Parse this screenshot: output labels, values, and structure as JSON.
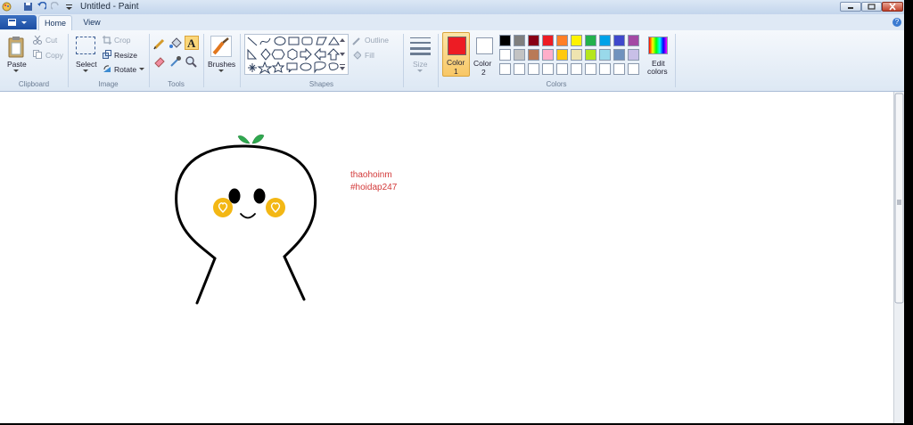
{
  "window": {
    "title": "Untitled - Paint"
  },
  "tabs": {
    "home": "Home",
    "view": "View"
  },
  "clipboard": {
    "paste": "Paste",
    "cut": "Cut",
    "copy": "Copy",
    "group": "Clipboard"
  },
  "image": {
    "select": "Select",
    "crop": "Crop",
    "resize": "Resize",
    "rotate": "Rotate",
    "group": "Image"
  },
  "tools": {
    "group": "Tools",
    "brushes": "Brushes"
  },
  "shapes": {
    "outline": "Outline",
    "fill": "Fill",
    "group": "Shapes"
  },
  "size": {
    "label": "Size"
  },
  "colors": {
    "color1_label": "Color",
    "color1_num": "1",
    "color2_label": "Color",
    "color2_num": "2",
    "edit_label": "Edit",
    "edit_label2": "colors",
    "group": "Colors",
    "primary": "#ed1c24",
    "secondary": "#ffffff",
    "row1": [
      "#000000",
      "#7f7f7f",
      "#880015",
      "#ed1c24",
      "#ff7f27",
      "#fff200",
      "#22b14c",
      "#00a2e8",
      "#3f48cc",
      "#a349a4"
    ],
    "row2": [
      "#ffffff",
      "#c3c3c3",
      "#b97a57",
      "#ffaec9",
      "#ffc90e",
      "#efe4b0",
      "#b5e61d",
      "#99d9ea",
      "#7092be",
      "#c8bfe7"
    ],
    "row3": [
      "#ffffff",
      "#ffffff",
      "#ffffff",
      "#ffffff",
      "#ffffff",
      "#ffffff",
      "#ffffff",
      "#ffffff",
      "#ffffff",
      "#ffffff"
    ]
  },
  "canvas": {
    "text_line1": "thaohoinm",
    "text_line2": "#hoidap247",
    "text_color": "#d33a3a",
    "sprout_color": "#2fa84f",
    "cheek_color": "#f3b714"
  }
}
